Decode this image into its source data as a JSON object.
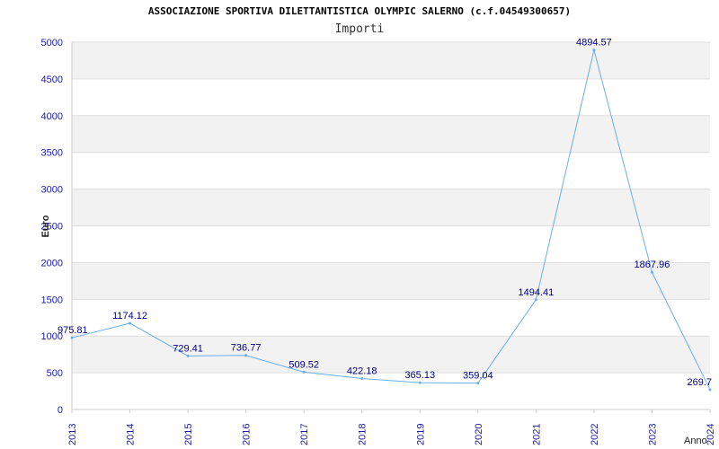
{
  "chart_data": {
    "type": "line",
    "title": "ASSOCIAZIONE SPORTIVA DILETTANTISTICA OLYMPIC SALERNO (c.f.04549300657)",
    "subtitle": "Importi",
    "xlabel": "Anno",
    "ylabel": "Euro",
    "ylim": [
      0,
      5000
    ],
    "yticks": [
      "0",
      "500",
      "1000",
      "1500",
      "2000",
      "2500",
      "3000",
      "3500",
      "4000",
      "4500",
      "5000"
    ],
    "categories": [
      "2013",
      "2014",
      "2015",
      "2016",
      "2017",
      "2018",
      "2019",
      "2020",
      "2021",
      "2022",
      "2023",
      "2024"
    ],
    "series": [
      {
        "values": [
          975.81,
          1174.12,
          729.41,
          736.77,
          509.52,
          422.18,
          365.13,
          359.04,
          1494.41,
          4894.57,
          1867.96,
          269.7
        ],
        "labels": [
          "975.81",
          "1174.12",
          "729.41",
          "736.77",
          "509.52",
          "422.18",
          "365.13",
          "359.04",
          "1494.41",
          "4894.57",
          "1867.96",
          "269.7"
        ]
      }
    ],
    "grid": true,
    "colors": {
      "line": "#6aaee8",
      "axis_text": "#1a1aa6",
      "data_label": "#000080",
      "band": "#f2f2f2",
      "grid": "#dddddd"
    }
  }
}
